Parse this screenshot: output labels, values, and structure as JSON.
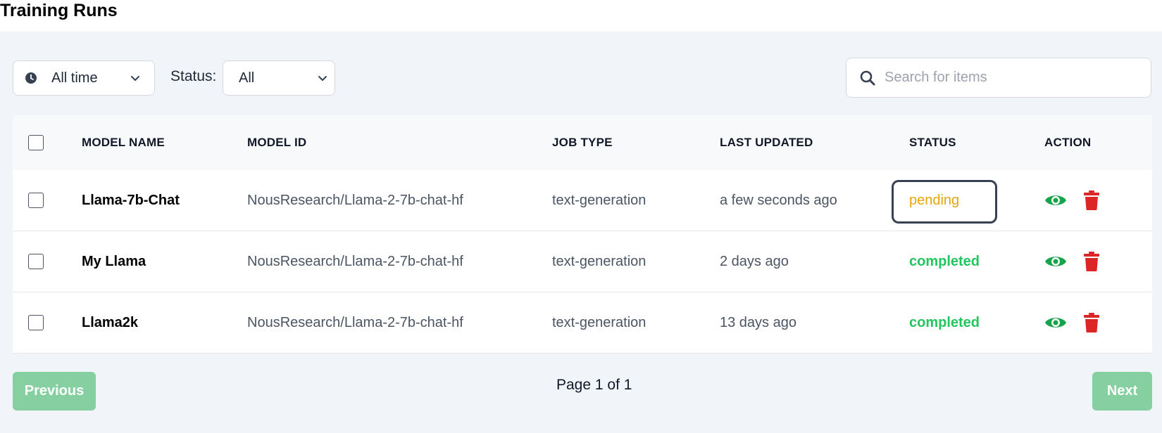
{
  "title": "Training Runs",
  "filters": {
    "time_range": "All time",
    "status_label": "Status:",
    "status_value": "All",
    "search_placeholder": "Search for items"
  },
  "table": {
    "columns": [
      "MODEL NAME",
      "MODEL ID",
      "JOB TYPE",
      "LAST UPDATED",
      "STATUS",
      "ACTION"
    ],
    "rows": [
      {
        "model_name": "Llama-7b-Chat",
        "model_id": "NousResearch/Llama-2-7b-chat-hf",
        "job_type": "text-generation",
        "last_updated": "a few seconds ago",
        "status": "pending"
      },
      {
        "model_name": "My Llama",
        "model_id": "NousResearch/Llama-2-7b-chat-hf",
        "job_type": "text-generation",
        "last_updated": "2 days ago",
        "status": "completed"
      },
      {
        "model_name": "Llama2k",
        "model_id": "NousResearch/Llama-2-7b-chat-hf",
        "job_type": "text-generation",
        "last_updated": "13 days ago",
        "status": "completed"
      }
    ]
  },
  "pagination": {
    "previous_label": "Previous",
    "page_info": "Page 1 of 1",
    "next_label": "Next"
  },
  "colors": {
    "panel_bg": "#f1f4f8",
    "pending": "#e6a50b",
    "completed": "#22c55e",
    "view_icon": "#16a34a",
    "delete_icon": "#dc2626",
    "button": "#86cfa1"
  },
  "icons": {
    "time_filter": "clock-icon",
    "dropdown": "chevron-down-icon",
    "search": "search-icon",
    "view": "eye-icon",
    "delete": "trash-icon"
  }
}
